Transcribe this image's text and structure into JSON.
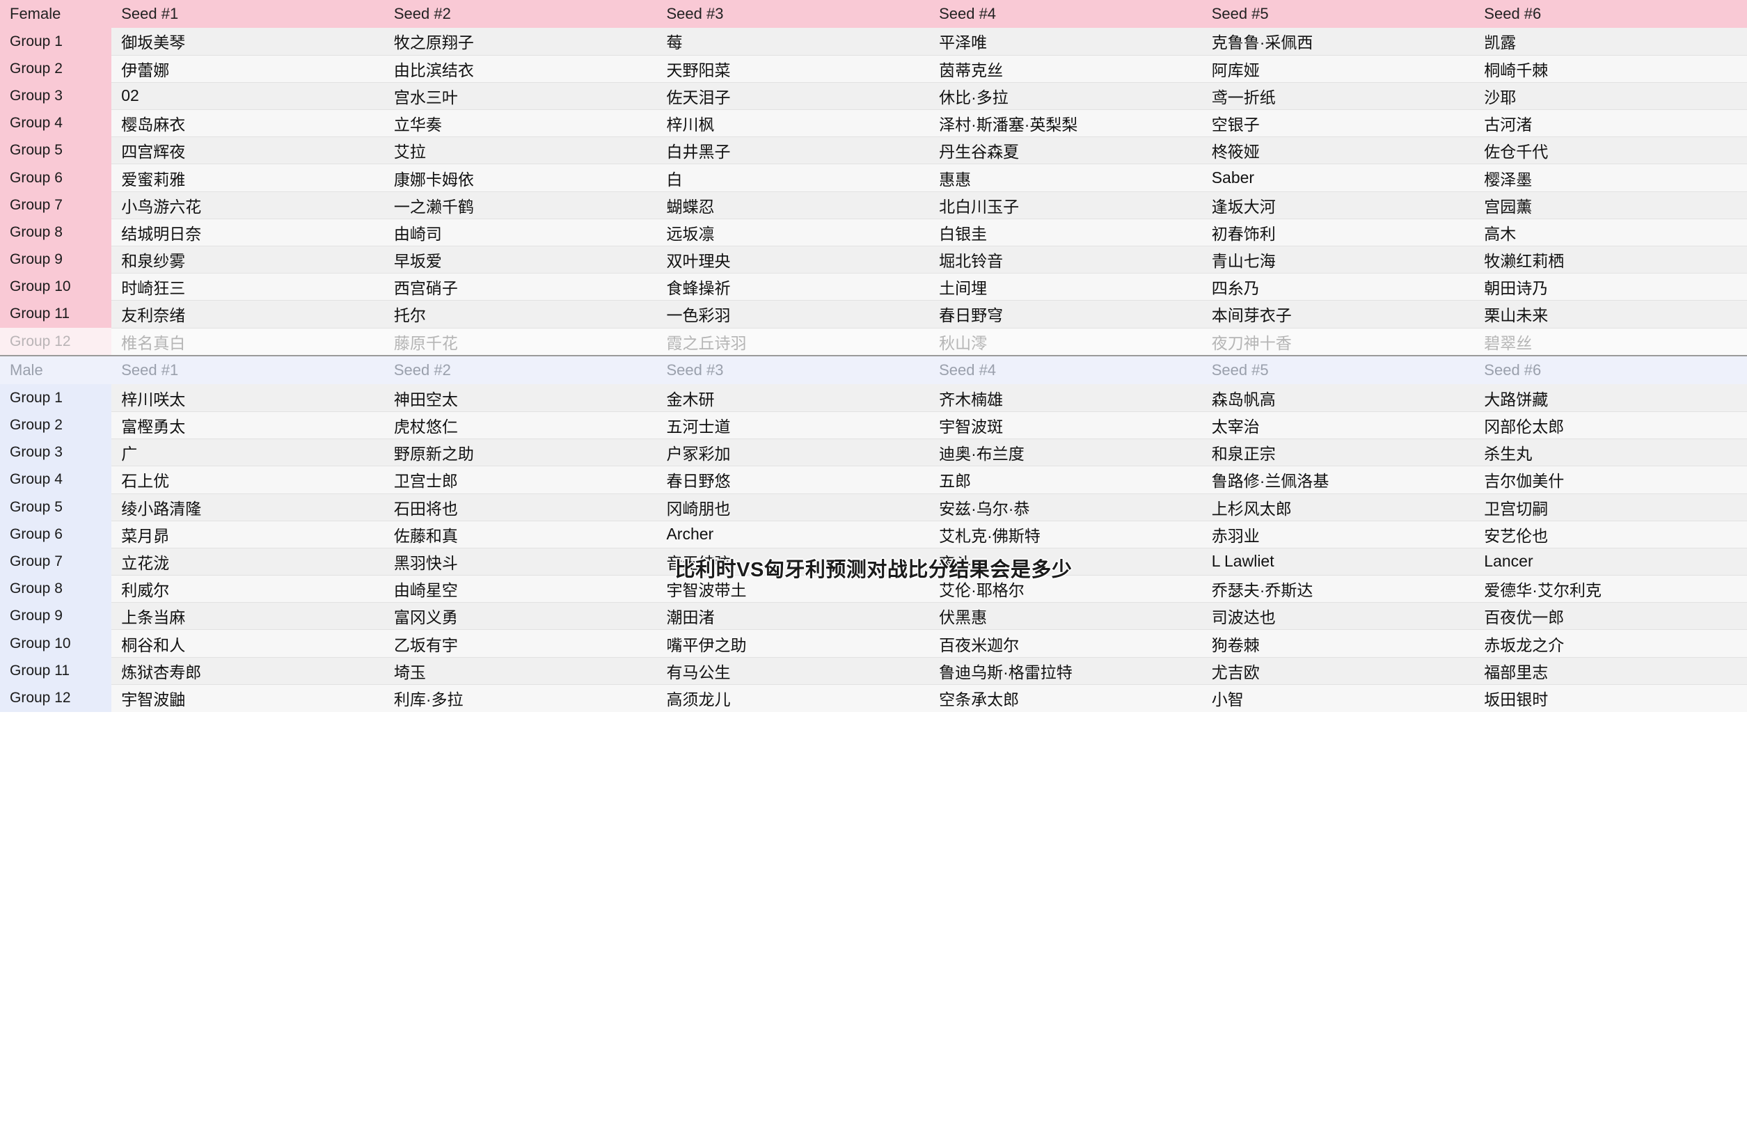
{
  "overlay": {
    "text": "比利时VS匈牙利预测对战比分结果会是多少"
  },
  "colors": {
    "female_accent": "#f9c9d5",
    "male_accent": "#e7ecfa",
    "male_header": "#eef1fb",
    "row_odd": "#f0f0f0",
    "row_even": "#f7f7f7",
    "divider": "#9a9a9a"
  },
  "female": {
    "corner_label": "Female",
    "headers": [
      "Seed #1",
      "Seed #2",
      "Seed #3",
      "Seed #4",
      "Seed #5",
      "Seed #6"
    ],
    "rows": [
      {
        "group": "Group 1",
        "seeds": [
          "御坂美琴",
          "牧之原翔子",
          "莓",
          "平泽唯",
          "克鲁鲁·采佩西",
          "凯露"
        ]
      },
      {
        "group": "Group 2",
        "seeds": [
          "伊蕾娜",
          "由比滨结衣",
          "天野阳菜",
          "茵蒂克丝",
          "阿库娅",
          "桐崎千棘"
        ]
      },
      {
        "group": "Group 3",
        "seeds": [
          "02",
          "宫水三叶",
          "佐天泪子",
          "休比·多拉",
          "鸢一折纸",
          "沙耶"
        ]
      },
      {
        "group": "Group 4",
        "seeds": [
          "樱岛麻衣",
          "立华奏",
          "梓川枫",
          "泽村·斯潘塞·英梨梨",
          "空银子",
          "古河渚"
        ]
      },
      {
        "group": "Group 5",
        "seeds": [
          "四宫辉夜",
          "艾拉",
          "白井黑子",
          "丹生谷森夏",
          "柊筱娅",
          "佐仓千代"
        ]
      },
      {
        "group": "Group 6",
        "seeds": [
          "爱蜜莉雅",
          "康娜卡姆依",
          "白",
          "惠惠",
          "Saber",
          "樱泽墨"
        ]
      },
      {
        "group": "Group 7",
        "seeds": [
          "小鸟游六花",
          "一之濑千鹤",
          "蝴蝶忍",
          "北白川玉子",
          "逢坂大河",
          "宫园薰"
        ]
      },
      {
        "group": "Group 8",
        "seeds": [
          "结城明日奈",
          "由崎司",
          "远坂凛",
          "白银圭",
          "初春饰利",
          "高木"
        ]
      },
      {
        "group": "Group 9",
        "seeds": [
          "和泉纱雾",
          "早坂爱",
          "双叶理央",
          "堀北铃音",
          "青山七海",
          "牧濑红莉栖"
        ]
      },
      {
        "group": "Group 10",
        "seeds": [
          "时崎狂三",
          "西宫硝子",
          "食蜂操祈",
          "土间埋",
          "四糸乃",
          "朝田诗乃"
        ]
      },
      {
        "group": "Group 11",
        "seeds": [
          "友利奈绪",
          "托尔",
          "一色彩羽",
          "春日野穹",
          "本间芽衣子",
          "栗山未来"
        ]
      },
      {
        "group": "Group 12",
        "seeds": [
          "椎名真白",
          "藤原千花",
          "霞之丘诗羽",
          "秋山澪",
          "夜刀神十香",
          "碧翠丝"
        ],
        "faded": true
      }
    ]
  },
  "male": {
    "corner_label": "Male",
    "headers": [
      "Seed #1",
      "Seed #2",
      "Seed #3",
      "Seed #4",
      "Seed #5",
      "Seed #6"
    ],
    "rows": [
      {
        "group": "Group 1",
        "seeds": [
          "梓川咲太",
          "神田空太",
          "金木研",
          "齐木楠雄",
          "森岛帆高",
          "大路饼藏"
        ]
      },
      {
        "group": "Group 2",
        "seeds": [
          "富樫勇太",
          "虎杖悠仁",
          "五河士道",
          "宇智波斑",
          "太宰治",
          "冈部伦太郎"
        ]
      },
      {
        "group": "Group 3",
        "seeds": [
          "广",
          "野原新之助",
          "户冢彩加",
          "迪奥·布兰度",
          "和泉正宗",
          "杀生丸"
        ]
      },
      {
        "group": "Group 4",
        "seeds": [
          "石上优",
          "卫宫士郎",
          "春日野悠",
          "五郎",
          "鲁路修·兰佩洛基",
          "吉尔伽美什"
        ]
      },
      {
        "group": "Group 5",
        "seeds": [
          "绫小路清隆",
          "石田将也",
          "冈崎朋也",
          "安兹·乌尔·恭",
          "上杉风太郎",
          "卫宫切嗣"
        ]
      },
      {
        "group": "Group 6",
        "seeds": [
          "菜月昴",
          "佐藤和真",
          "Archer",
          "艾札克·佛斯特",
          "赤羽业",
          "安艺伦也"
        ]
      },
      {
        "group": "Group 7",
        "seeds": [
          "立花泷",
          "黑羽快斗",
          "音无结弦",
          "夜斗",
          "L Lawliet",
          "Lancer"
        ]
      },
      {
        "group": "Group 8",
        "seeds": [
          "利威尔",
          "由崎星空",
          "宇智波带土",
          "艾伦·耶格尔",
          "乔瑟夫·乔斯达",
          "爱德华·艾尔利克"
        ]
      },
      {
        "group": "Group 9",
        "seeds": [
          "上条当麻",
          "富冈义勇",
          "潮田渚",
          "伏黑惠",
          "司波达也",
          "百夜优一郎"
        ]
      },
      {
        "group": "Group 10",
        "seeds": [
          "桐谷和人",
          "乙坂有宇",
          "嘴平伊之助",
          "百夜米迦尔",
          "狗卷棘",
          "赤坂龙之介"
        ]
      },
      {
        "group": "Group 11",
        "seeds": [
          "炼狱杏寿郎",
          "埼玉",
          "有马公生",
          "鲁迪乌斯·格雷拉特",
          "尤吉欧",
          "福部里志"
        ]
      },
      {
        "group": "Group 12",
        "seeds": [
          "宇智波鼬",
          "利库·多拉",
          "高须龙儿",
          "空条承太郎",
          "小智",
          "坂田银时"
        ]
      }
    ]
  }
}
